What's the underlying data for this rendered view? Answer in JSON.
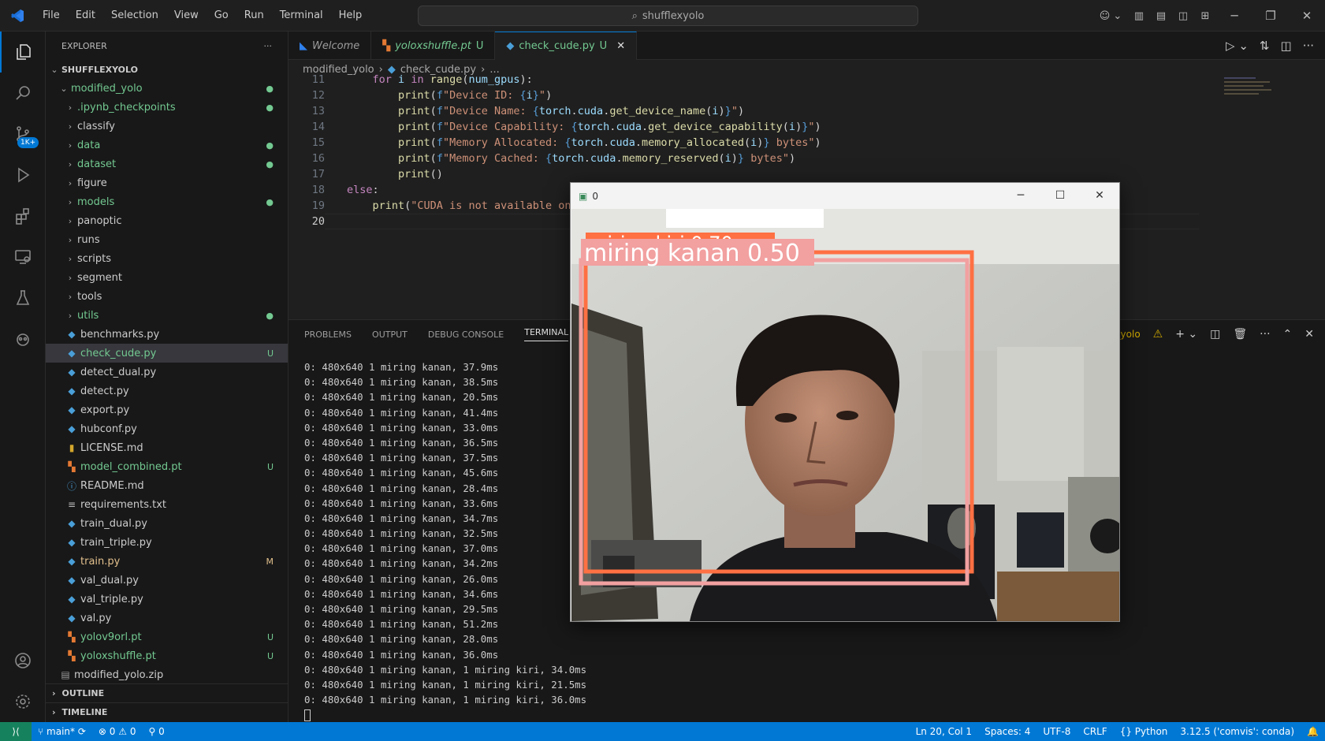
{
  "titlebar": {
    "menu": [
      "File",
      "Edit",
      "Selection",
      "View",
      "Go",
      "Run",
      "Terminal",
      "Help"
    ],
    "search": "shufflexyolo"
  },
  "activity": {
    "scm_badge": "1K+"
  },
  "sidebar": {
    "header": "EXPLORER",
    "header_more": "···",
    "root": "SHUFFLEXYOLO",
    "folder": "modified_yolo",
    "items": [
      {
        "label": ".ipynb_checkpoints",
        "type": "dir",
        "color": "green",
        "status": "●"
      },
      {
        "label": "classify",
        "type": "dir",
        "color": "none",
        "status": ""
      },
      {
        "label": "data",
        "type": "dir",
        "color": "green",
        "status": "●"
      },
      {
        "label": "dataset",
        "type": "dir",
        "color": "green",
        "status": "●"
      },
      {
        "label": "figure",
        "type": "dir",
        "color": "none",
        "status": ""
      },
      {
        "label": "models",
        "type": "dir",
        "color": "green",
        "status": "●"
      },
      {
        "label": "panoptic",
        "type": "dir",
        "color": "none",
        "status": ""
      },
      {
        "label": "runs",
        "type": "dir",
        "color": "none",
        "status": ""
      },
      {
        "label": "scripts",
        "type": "dir",
        "color": "none",
        "status": ""
      },
      {
        "label": "segment",
        "type": "dir",
        "color": "none",
        "status": ""
      },
      {
        "label": "tools",
        "type": "dir",
        "color": "none",
        "status": ""
      },
      {
        "label": "utils",
        "type": "dir",
        "color": "green",
        "status": "●"
      },
      {
        "label": "benchmarks.py",
        "type": "py",
        "color": "none",
        "status": ""
      },
      {
        "label": "check_cude.py",
        "type": "py",
        "color": "green",
        "status": "U",
        "selected": true
      },
      {
        "label": "detect_dual.py",
        "type": "py",
        "color": "none",
        "status": ""
      },
      {
        "label": "detect.py",
        "type": "py",
        "color": "none",
        "status": ""
      },
      {
        "label": "export.py",
        "type": "py",
        "color": "none",
        "status": ""
      },
      {
        "label": "hubconf.py",
        "type": "py",
        "color": "none",
        "status": ""
      },
      {
        "label": "LICENSE.md",
        "type": "md",
        "color": "none",
        "status": ""
      },
      {
        "label": "model_combined.pt",
        "type": "pt",
        "color": "green",
        "status": "U"
      },
      {
        "label": "README.md",
        "type": "info",
        "color": "none",
        "status": ""
      },
      {
        "label": "requirements.txt",
        "type": "txt",
        "color": "none",
        "status": ""
      },
      {
        "label": "train_dual.py",
        "type": "py",
        "color": "none",
        "status": ""
      },
      {
        "label": "train_triple.py",
        "type": "py",
        "color": "none",
        "status": ""
      },
      {
        "label": "train.py",
        "type": "py",
        "color": "yellow",
        "status": "M"
      },
      {
        "label": "val_dual.py",
        "type": "py",
        "color": "none",
        "status": ""
      },
      {
        "label": "val_triple.py",
        "type": "py",
        "color": "none",
        "status": ""
      },
      {
        "label": "val.py",
        "type": "py",
        "color": "none",
        "status": ""
      },
      {
        "label": "yolov9orl.pt",
        "type": "pt",
        "color": "green",
        "status": "U"
      },
      {
        "label": "yoloxshuffle.pt",
        "type": "pt",
        "color": "green",
        "status": "U"
      }
    ],
    "zip": "modified_yolo.zip",
    "outline": "OUTLINE",
    "timeline": "TIMELINE"
  },
  "tabs": [
    {
      "label": "Welcome",
      "status": "",
      "active": false
    },
    {
      "label": "yoloxshuffle.pt",
      "status": "U",
      "active": false
    },
    {
      "label": "check_cude.py",
      "status": "U",
      "active": true
    }
  ],
  "breadcrumb": {
    "folder": "modified_yolo",
    "file": "check_cude.py",
    "more": "..."
  },
  "editor": {
    "line_numbers": [
      "11",
      "12",
      "13",
      "14",
      "15",
      "16",
      "17",
      "18",
      "19",
      "20"
    ],
    "current_line": "20"
  },
  "panel": {
    "tabs": [
      "PROBLEMS",
      "OUTPUT",
      "DEBUG CONSOLE",
      "TERMINAL"
    ],
    "active": "TERMINAL",
    "terminal_name": "d_yolo",
    "lines": [
      "0: 480x640 1 miring kanan, 37.9ms",
      "0: 480x640 1 miring kanan, 38.5ms",
      "0: 480x640 1 miring kanan, 20.5ms",
      "0: 480x640 1 miring kanan, 41.4ms",
      "0: 480x640 1 miring kanan, 33.0ms",
      "0: 480x640 1 miring kanan, 36.5ms",
      "0: 480x640 1 miring kanan, 37.5ms",
      "0: 480x640 1 miring kanan, 45.6ms",
      "0: 480x640 1 miring kanan, 28.4ms",
      "0: 480x640 1 miring kanan, 33.6ms",
      "0: 480x640 1 miring kanan, 34.7ms",
      "0: 480x640 1 miring kanan, 32.5ms",
      "0: 480x640 1 miring kanan, 37.0ms",
      "0: 480x640 1 miring kanan, 34.2ms",
      "0: 480x640 1 miring kanan, 26.0ms",
      "0: 480x640 1 miring kanan, 34.6ms",
      "0: 480x640 1 miring kanan, 29.5ms",
      "0: 480x640 1 miring kanan, 51.2ms",
      "0: 480x640 1 miring kanan, 28.0ms",
      "0: 480x640 1 miring kanan, 36.0ms",
      "0: 480x640 1 miring kanan, 1 miring kiri, 34.0ms",
      "0: 480x640 1 miring kanan, 1 miring kiri, 21.5ms",
      "0: 480x640 1 miring kanan, 1 miring kiri, 36.0ms"
    ]
  },
  "camera_window": {
    "title": "0",
    "label_front": "miring kanan 0.50",
    "label_back": "miring kiri 0.70"
  },
  "statusbar": {
    "branch": "main*",
    "errors": "0",
    "warnings": "0",
    "ports": "0",
    "position": "Ln 20, Col 1",
    "spaces": "Spaces: 4",
    "encoding": "UTF-8",
    "eol": "CRLF",
    "language": "Python",
    "interpreter": "3.12.5 ('comvis': conda)"
  },
  "colors": {
    "accent": "#0078d4",
    "box_front": "#f2a0a0",
    "box_back": "#ff7043"
  }
}
